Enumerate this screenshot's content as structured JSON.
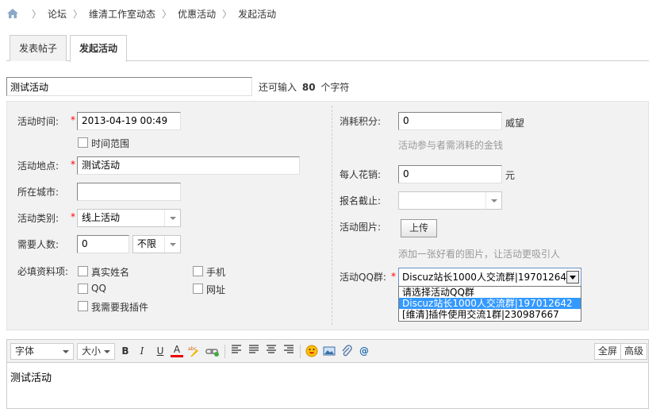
{
  "breadcrumb": [
    "论坛",
    "维清工作室动态",
    "优惠活动",
    "发起活动"
  ],
  "tabs": [
    "发表帖子",
    "发起活动"
  ],
  "subject": {
    "value": "测试活动",
    "remain_prefix": "还可输入",
    "remain_count": "80",
    "remain_suffix": "个字符"
  },
  "left": {
    "time_label": "活动时间:",
    "time_value": "2013-04-19 00:49",
    "range_label": "时间范围",
    "place_label": "活动地点:",
    "place_value": "测试活动",
    "city_label": "所在城市:",
    "city_value": "",
    "category_label": "活动类别:",
    "category_value": "线上活动",
    "people_label": "需要人数:",
    "people_value": "0",
    "people_limit": "不限",
    "required_label": "必填资料项:",
    "required_items": [
      "真实姓名",
      "手机",
      "QQ",
      "网址",
      "我需要我插件"
    ]
  },
  "right": {
    "credit_label": "消耗积分:",
    "credit_value": "0",
    "credit_unit": "威望",
    "credit_hint": "活动参与者需消耗的金钱",
    "cost_label": "每人花销:",
    "cost_value": "0",
    "cost_unit": "元",
    "deadline_label": "报名截止:",
    "deadline_value": "",
    "image_label": "活动图片:",
    "upload_label": "上传",
    "image_hint": "添加一张好看的图片，让活动更吸引人",
    "qq_label": "活动QQ群:",
    "qq_value": "Discuz站长1000人交流群|197012642",
    "qq_options": [
      "请选择活动QQ群",
      "Discuz站长1000人交流群|197012642",
      "[维清]插件使用交流1群|230987667"
    ]
  },
  "editor": {
    "font_label": "字体",
    "size_label": "大小",
    "fullscreen_label": "全屏",
    "advanced_label": "高级",
    "content": "测试活动"
  },
  "colors": {
    "required": "#ff0000",
    "highlight": "#3399ff",
    "panel": "#f2f2f2"
  }
}
